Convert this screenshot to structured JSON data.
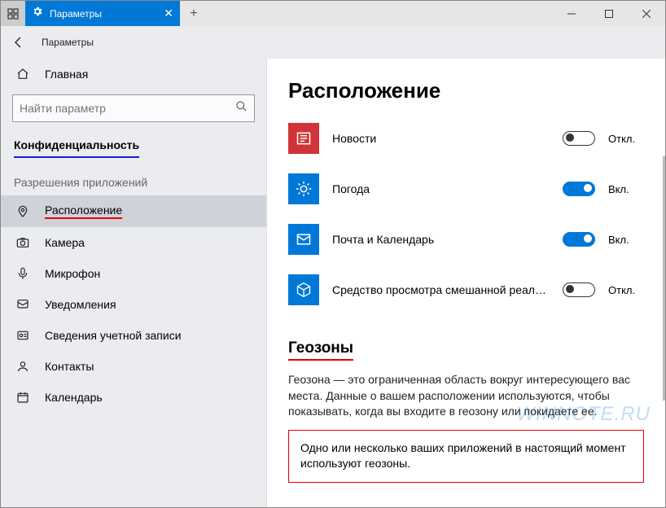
{
  "titlebar": {
    "tab_title": "Параметры",
    "tab_close": "✕",
    "newtab": "+"
  },
  "header": {
    "breadcrumb": "Параметры"
  },
  "sidebar": {
    "home": "Главная",
    "search_placeholder": "Найти параметр",
    "section": "Конфиденциальность",
    "subhead": "Разрешения приложений",
    "items": {
      "location": "Расположение",
      "camera": "Камера",
      "microphone": "Микрофон",
      "notifications": "Уведомления",
      "account": "Сведения учетной записи",
      "contacts": "Контакты",
      "calendar": "Календарь"
    }
  },
  "content": {
    "title": "Расположение",
    "apps": {
      "news": {
        "name": "Новости",
        "state": "Откл."
      },
      "weather": {
        "name": "Погода",
        "state": "Вкл."
      },
      "mail": {
        "name": "Почта и Календарь",
        "state": "Вкл."
      },
      "mr": {
        "name": "Средство просмотра смешанной реальн...",
        "state": "Откл."
      }
    },
    "geo_title": "Геозоны",
    "geo_desc": "Геозона — это ограниченная область вокруг интересующего вас места. Данные о вашем расположении используются, чтобы показывать, когда вы входите в геозону или покидаете ее.",
    "geo_box": "Одно или несколько ваших приложений в настоящий момент используют геозоны.",
    "watermark": "WINNOTE.RU"
  }
}
